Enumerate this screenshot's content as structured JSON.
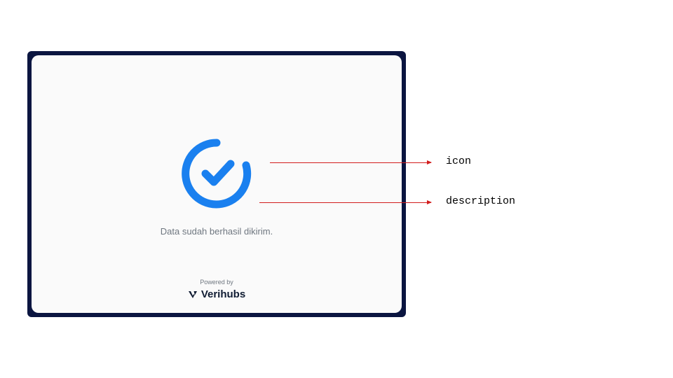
{
  "colors": {
    "frame": "#0b1540",
    "panel_bg": "#fafafa",
    "accent": "#1a80ef",
    "muted_text": "#6f7780",
    "brand_text": "#101c33",
    "arrow": "#d21d1d"
  },
  "panel": {
    "icon_name": "success-check-circle",
    "description": "Data sudah berhasil dikirim.",
    "footer": {
      "powered_by_label": "Powered by",
      "brand_name": "Verihubs",
      "brand_mark_icon": "verihubs-v-mark"
    }
  },
  "annotations": {
    "icon_label": "icon",
    "description_label": "description"
  }
}
